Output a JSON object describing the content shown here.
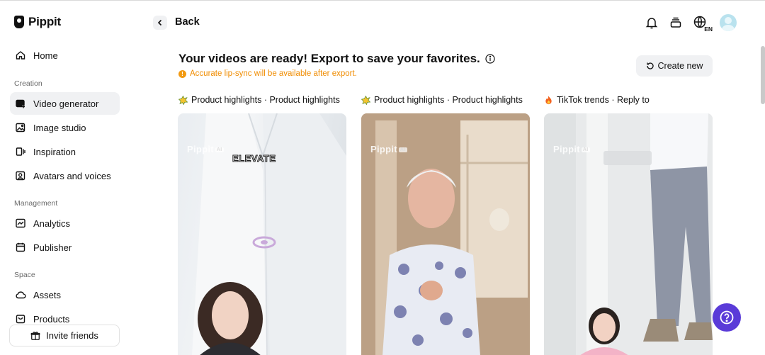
{
  "app": {
    "name": "Pippit"
  },
  "sidebar": {
    "home": "Home",
    "sections": {
      "creation": "Creation",
      "management": "Management",
      "space": "Space"
    },
    "creation_items": [
      {
        "label": "Video generator",
        "icon": "video-plus-icon",
        "active": true
      },
      {
        "label": "Image studio",
        "icon": "image-edit-icon"
      },
      {
        "label": "Inspiration",
        "icon": "inspiration-icon"
      },
      {
        "label": "Avatars and voices",
        "icon": "avatar-icon"
      }
    ],
    "management_items": [
      {
        "label": "Analytics",
        "icon": "chart-icon"
      },
      {
        "label": "Publisher",
        "icon": "calendar-icon"
      }
    ],
    "space_items": [
      {
        "label": "Assets",
        "icon": "cloud-icon"
      },
      {
        "label": "Products",
        "icon": "bag-icon"
      }
    ],
    "invite": "Invite friends"
  },
  "topbar": {
    "back": "Back",
    "lang": "EN"
  },
  "main": {
    "headline": "Your videos are ready! Export to save your favorites.",
    "warning": "Accurate lip-sync will be available after export.",
    "warning_icon": "!",
    "create_new": "Create new",
    "videos": [
      {
        "title": "Product highlights · Product highlights",
        "badge": "star-badge-icon",
        "watermark": "Pippit",
        "watermark_badge": "AI",
        "caption": "ELEVATE"
      },
      {
        "title": "Product highlights · Product highlights",
        "badge": "star-badge-icon",
        "watermark": "Pippit",
        "watermark_badge": "AI"
      },
      {
        "title": "TikTok trends · Reply to",
        "badge": "fire-badge-icon",
        "watermark": "Pippit",
        "watermark_badge": "AI"
      }
    ]
  },
  "colors": {
    "accent": "#5a3bd8",
    "warning": "#f08c00",
    "active_bg": "#f0f1f3"
  }
}
